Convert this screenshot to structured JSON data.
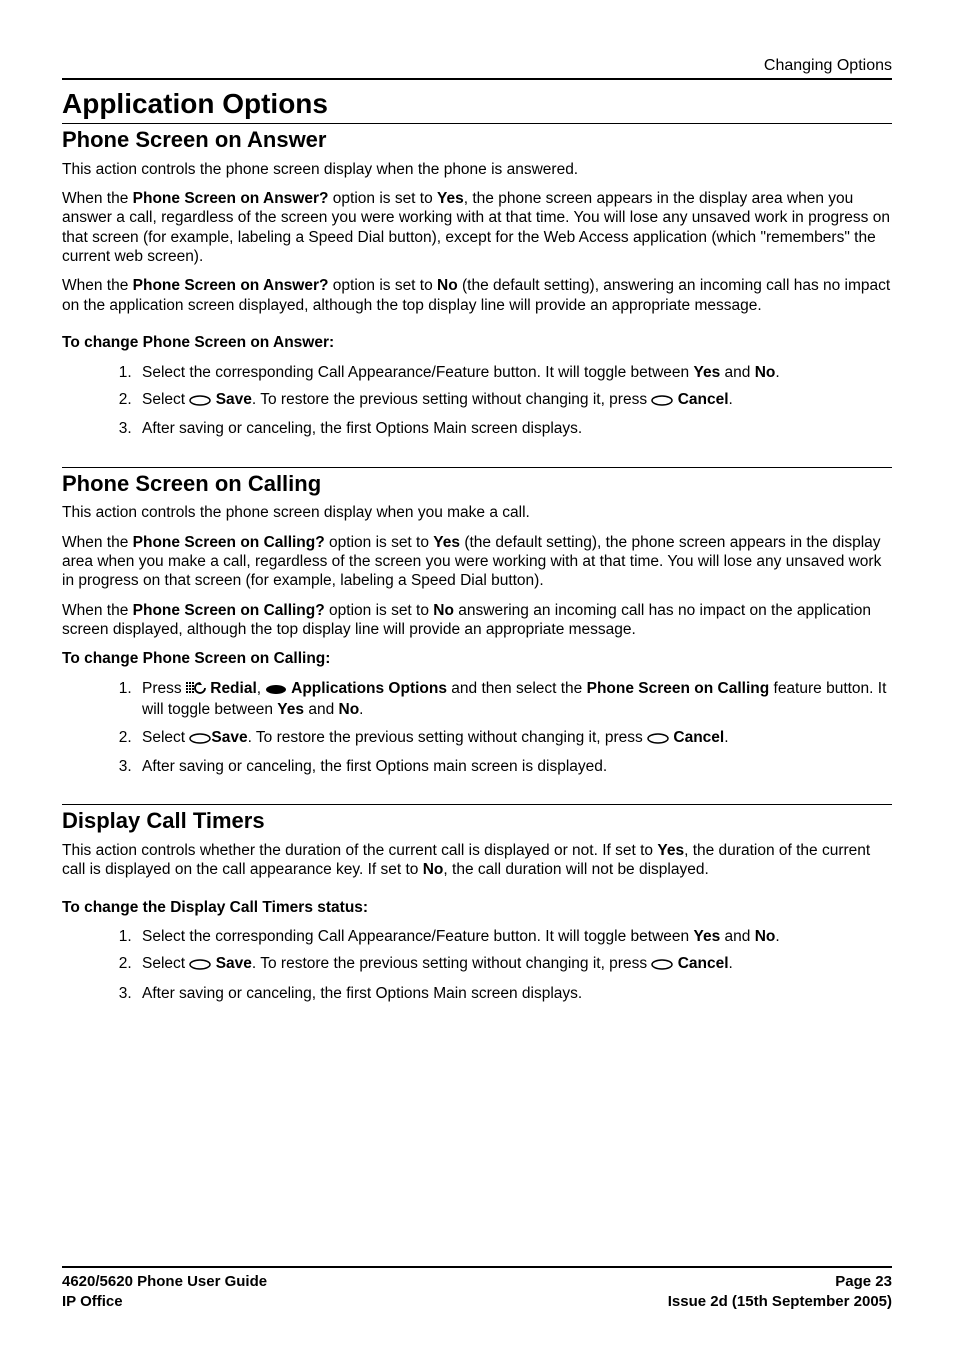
{
  "header": {
    "section_label": "Changing Options"
  },
  "title": "Application Options",
  "sec1": {
    "heading": "Phone Screen on Answer",
    "intro": "This action controls the phone screen display when the phone is answered.",
    "p2_a": "When the ",
    "p2_opt": "Phone Screen on Answer?",
    "p2_b": " option is set to ",
    "p2_yes": "Yes",
    "p2_c": ", the phone screen appears in the display area when you answer a call, regardless of the screen you were working with at that time. You will lose any unsaved work in progress on that screen (for example, labeling a Speed Dial button), except for the Web Access application (which \"remembers\" the current web screen).",
    "p3_a": "When the ",
    "p3_opt": "Phone Screen on Answer?",
    "p3_b": " option is set to ",
    "p3_no": "No",
    "p3_c": " (the default setting), answering an incoming call has no impact on the application screen displayed, although the top display line will provide an appropriate message.",
    "howto": "To change Phone Screen on Answer:",
    "step1_a": "Select the corresponding Call Appearance/Feature button. It will toggle between ",
    "step1_yes": "Yes",
    "step1_and": " and ",
    "step1_no": "No",
    "step1_end": ".",
    "step2_a": "Select ",
    "step2_save": " Save",
    "step2_b": ". To restore the previous setting without changing it, press ",
    "step2_cancel": " Cancel",
    "step2_end": ".",
    "step3": "After saving or canceling, the first Options Main screen displays."
  },
  "sec2": {
    "heading": "Phone Screen on Calling",
    "intro": "This action controls the phone screen display when you make a call.",
    "p2_a": "When the ",
    "p2_opt": "Phone Screen on Calling?",
    "p2_b": " option is set to ",
    "p2_yes": "Yes",
    "p2_c": " (the default setting), the phone screen appears in the display area when you make a call, regardless of the screen you were working with at that time. You will lose any unsaved work in progress on that screen (for example, labeling a Speed Dial button).",
    "p3_a": "When the ",
    "p3_opt": "Phone Screen on Calling?",
    "p3_b": " option is set to ",
    "p3_no": "No",
    "p3_c": " answering an incoming call has no impact on the application screen displayed, although the top display line will provide an appropriate message.",
    "howto": "To change Phone Screen on Calling:",
    "step1_a": "Press ",
    "step1_redial": " Redial",
    "step1_comma": ", ",
    "step1_appopt": " Applications Options",
    "step1_b": " and then select the ",
    "step1_feat": "Phone Screen on Calling",
    "step1_c": " feature button. It will toggle between ",
    "step1_yes": "Yes",
    "step1_and": " and ",
    "step1_no": "No",
    "step1_end": ".",
    "step2_a": "Select ",
    "step2_save": "Save",
    "step2_b": ". To restore the previous setting without changing it, press ",
    "step2_cancel": " Cancel",
    "step2_end": ".",
    "step3": "After saving or canceling, the first Options main screen is displayed."
  },
  "sec3": {
    "heading": "Display Call Timers",
    "p1_a": "This action controls whether the duration of the current call is displayed or not. If set to ",
    "p1_yes": "Yes",
    "p1_b": ", the duration of the current call is displayed on the call appearance key. If set to ",
    "p1_no": "No",
    "p1_c": ", the call duration will not be displayed.",
    "howto": "To change the Display Call Timers status:",
    "step1_a": "Select the corresponding Call Appearance/Feature button. It will toggle between ",
    "step1_yes": "Yes",
    "step1_and": " and ",
    "step1_no": "No",
    "step1_end": ".",
    "step2_a": "Select ",
    "step2_save": " Save",
    "step2_b": ". To restore the previous setting without changing it, press ",
    "step2_cancel": " Cancel",
    "step2_end": ".",
    "step3": "After saving or canceling, the first Options Main screen displays."
  },
  "footer": {
    "left1": "4620/5620 Phone User Guide",
    "left2": "IP Office",
    "right1": "Page 23",
    "right2": "Issue 2d (15th September 2005)"
  }
}
